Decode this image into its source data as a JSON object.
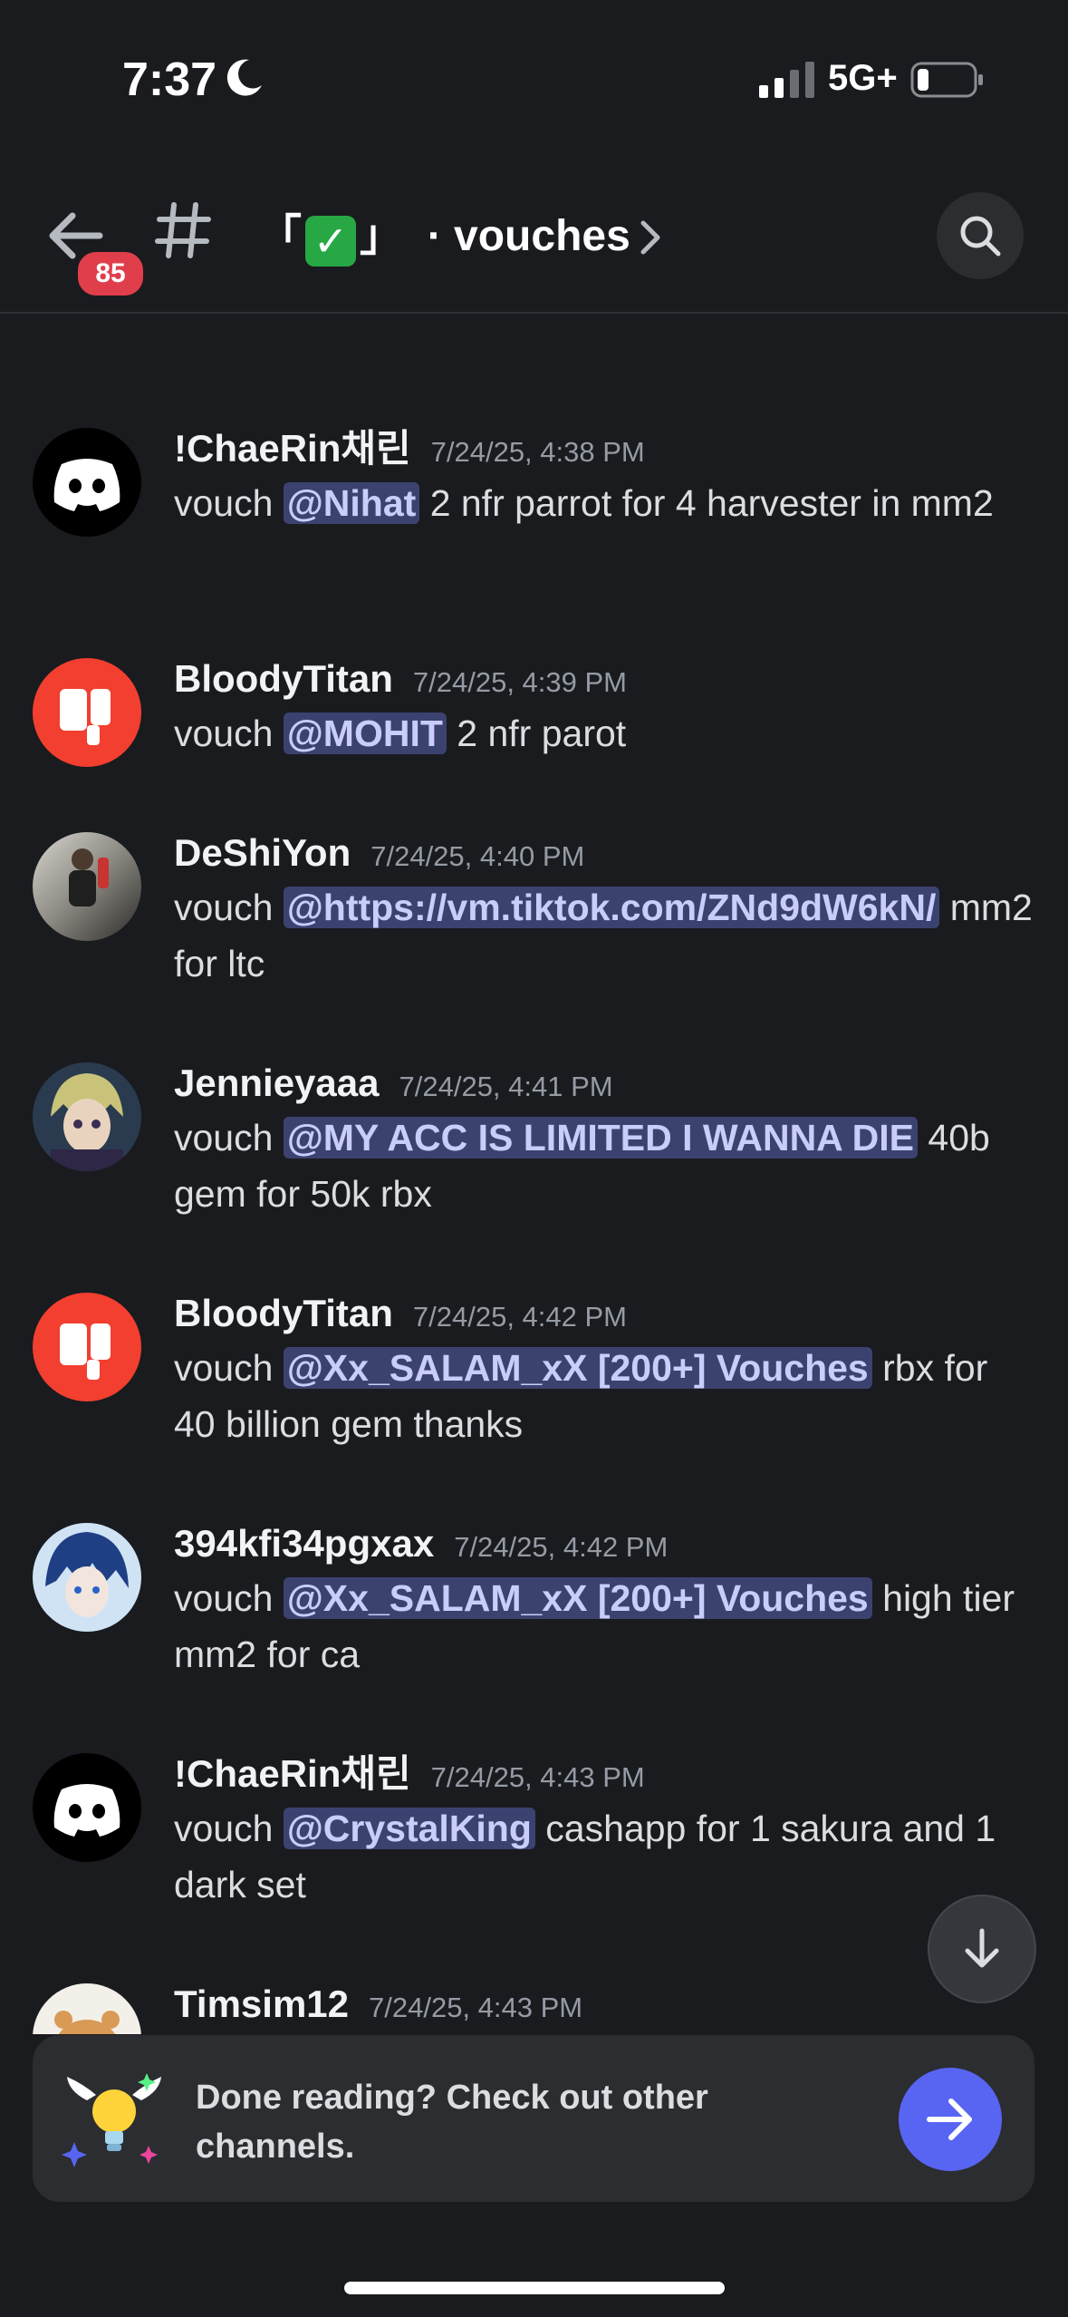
{
  "status_bar": {
    "time": "7:37",
    "network": "5G+"
  },
  "header": {
    "unread_badge": "85",
    "channel_prefix": "「",
    "channel_check": "✓",
    "channel_suffix": "」",
    "channel_dot": "·",
    "channel_title": "vouches"
  },
  "messages": [
    {
      "author": "!ChaeRin채린",
      "timestamp": "7/24/25, 4:38 PM",
      "prefix": "vouch ",
      "mention": "@Nihat",
      "text": " 2 nfr parrot for 4 harvester in mm2",
      "avatar": "discord-logo"
    },
    {
      "author": "BloodyTitan",
      "timestamp": "7/24/25, 4:39 PM",
      "prefix": "vouch ",
      "mention": "@MOHIT",
      "text": "  2 nfr parot",
      "avatar": "thumbs-down"
    },
    {
      "author": "DeShiYon",
      "timestamp": "7/24/25, 4:40 PM",
      "prefix": "vouch ",
      "mention": "@https://vm.tiktok.com/ZNd9dW6kN/",
      "text": " mm2 for ltc",
      "avatar": "photo-person"
    },
    {
      "author": "Jennieyaaa",
      "timestamp": "7/24/25, 4:41 PM",
      "prefix": "vouch ",
      "mention": "@MY ACC IS LIMITED I WANNA DIE",
      "text": " 40b gem for 50k rbx",
      "avatar": "anime-character"
    },
    {
      "author": "BloodyTitan",
      "timestamp": "7/24/25, 4:42 PM",
      "prefix": "vouch ",
      "mention": "@Xx_SALAM_xX [200+] Vouches",
      "text": " rbx for 40 billion gem thanks",
      "avatar": "thumbs-down"
    },
    {
      "author": "394kfi34pgxax",
      "timestamp": "7/24/25, 4:42 PM",
      "prefix": "vouch ",
      "mention": "@Xx_SALAM_xX [200+] Vouches",
      "text": " high tier mm2 for ca",
      "avatar": "anime-blue"
    },
    {
      "author": "!ChaeRin채린",
      "timestamp": "7/24/25, 4:43 PM",
      "prefix": "vouch ",
      "mention": "@CrystalKing",
      "text": " cashapp for 1 sakura and 1 dark set",
      "avatar": "discord-logo"
    },
    {
      "author": "Timsim12",
      "timestamp": "7/24/25, 4:43 PM",
      "prefix": "",
      "mention": "",
      "text": "",
      "avatar": "hamster"
    }
  ],
  "done_card": {
    "text": "Done reading? Check out other channels."
  },
  "colors": {
    "accent": "#5865f2",
    "badge": "#e03e4b",
    "mention_bg": "#3c4270",
    "background": "#1a1b1f"
  }
}
